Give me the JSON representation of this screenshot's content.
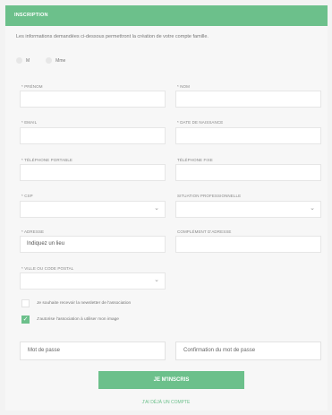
{
  "header": {
    "title": "INSCRIPTION"
  },
  "intro": "Les informations demandées ci-dessous permettront la création de votre compte famille.",
  "civility": {
    "options": [
      "M",
      "Mme"
    ]
  },
  "fields": {
    "prenom": {
      "label": "* PRÉNOM",
      "value": ""
    },
    "nom": {
      "label": "* NOM",
      "value": ""
    },
    "email": {
      "label": "* EMAIL",
      "value": ""
    },
    "naissance": {
      "label": "* DATE DE NAISSANCE",
      "value": ""
    },
    "portable": {
      "label": "* TÉLÉPHONE PORTABLE",
      "value": ""
    },
    "fixe": {
      "label": "TÉLÉPHONE FIXE",
      "value": ""
    },
    "csp": {
      "label": "* CSP",
      "value": ""
    },
    "situation": {
      "label": "SITUATION PROFESSIONNELLE",
      "value": ""
    },
    "adresse": {
      "label": "* ADRESSE",
      "value": "Indiquez un lieu"
    },
    "complement": {
      "label": "COMPLÉMENT D'ADRESSE",
      "value": ""
    },
    "ville": {
      "label": "* VILLE OU CODE POSTAL",
      "value": ""
    }
  },
  "checkboxes": {
    "newsletter": {
      "label": "Je souhaite recevoir la newsletter de l'association",
      "checked": false
    },
    "image": {
      "label": "J'autorise l'association à utiliser mon image",
      "checked": true
    }
  },
  "password": {
    "placeholder": "Mot de passe"
  },
  "password_confirm": {
    "placeholder": "Confirmation du mot de passe"
  },
  "submit_label": "JE M'INSCRIS",
  "login_link": "J'AI DÉJÀ UN COMPTE",
  "colors": {
    "accent": "#6cc08b"
  }
}
